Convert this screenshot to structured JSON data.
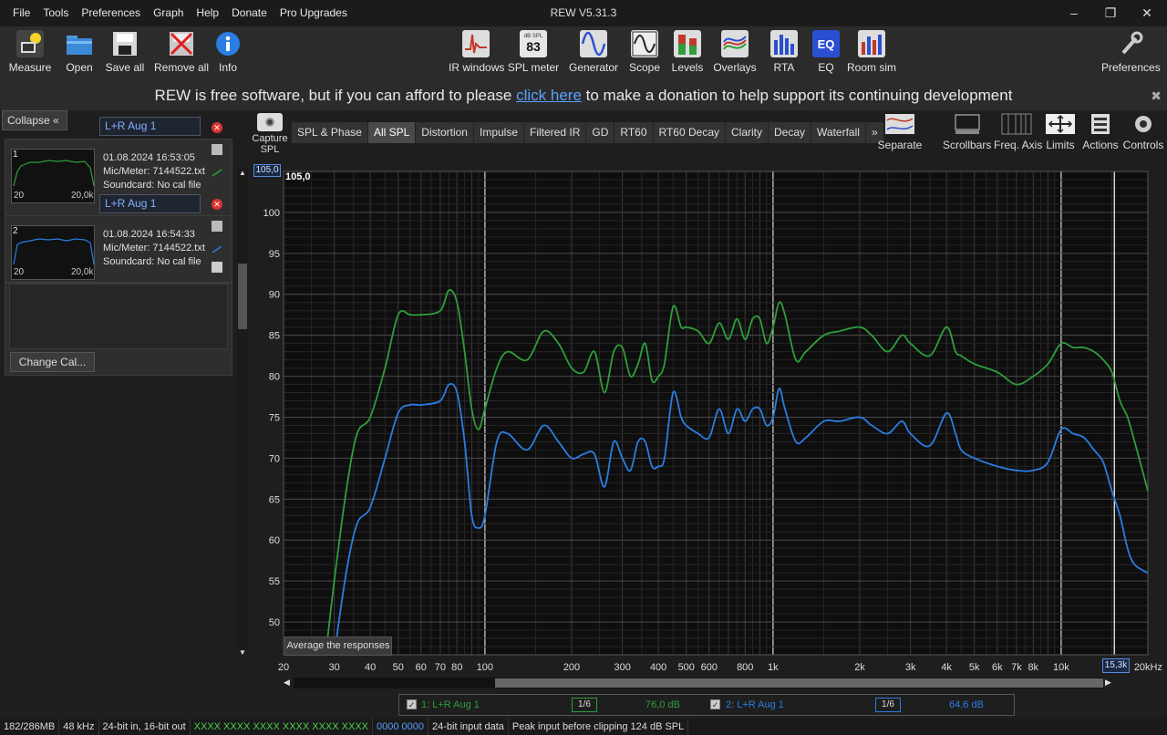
{
  "window": {
    "title": "REW V5.31.3"
  },
  "menu": [
    "File",
    "Tools",
    "Preferences",
    "Graph",
    "Help",
    "Donate",
    "Pro Upgrades"
  ],
  "toolbar_left": [
    "Measure",
    "Open",
    "Save all",
    "Remove all",
    "Info"
  ],
  "toolbar_center": [
    "IR windows",
    "SPL meter",
    "Generator",
    "Scope",
    "Levels",
    "Overlays",
    "RTA",
    "EQ",
    "Room sim"
  ],
  "spl_meter_icon": {
    "unit": "dB SPL",
    "value": "83"
  },
  "eq_icon_text": "EQ",
  "toolbar_right": "Preferences",
  "banner": {
    "before": "REW is free software, but if you can afford to please ",
    "link": "click here",
    "after": " to make a donation to help support its continuing development"
  },
  "left_panel": {
    "collapse": "Collapse",
    "measurements": [
      {
        "num": "1",
        "name": "L+R Aug 1",
        "date": "01.08.2024 16:53:05",
        "mic": "Mic/Meter: 7144522.txt",
        "soundcard": "Soundcard: No cal file",
        "thumb_left": "20",
        "thumb_right": "20,0k",
        "color": "#2e9e3a"
      },
      {
        "num": "2",
        "name": "L+R Aug 1",
        "date": "01.08.2024 16:54:33",
        "mic": "Mic/Meter: 7144522.txt",
        "soundcard": "Soundcard: No cal file",
        "thumb_left": "20",
        "thumb_right": "20,0k",
        "color": "#2a7de1"
      }
    ],
    "change_cal": "Change Cal..."
  },
  "capture": {
    "label": "Capture",
    "sub": "SPL"
  },
  "tabs": [
    "SPL & Phase",
    "All SPL",
    "Distortion",
    "Impulse",
    "Filtered IR",
    "GD",
    "RT60",
    "RT60 Decay",
    "Clarity",
    "Decay",
    "Waterfall",
    "»"
  ],
  "active_tab": "All SPL",
  "right_tools": [
    "Separate",
    "Scrollbars",
    "Freq. Axis",
    "Limits",
    "Actions",
    "Controls"
  ],
  "graph": {
    "y_top_label": "105,0",
    "avg_button": "Average the responses",
    "cursor_x": "15,3k"
  },
  "chart_data": {
    "type": "line",
    "xscale": "log",
    "xlim": [
      20,
      20000
    ],
    "ylim": [
      46,
      105
    ],
    "x_ticks": [
      {
        "v": 20,
        "t": "20"
      },
      {
        "v": 30,
        "t": "30"
      },
      {
        "v": 40,
        "t": "40"
      },
      {
        "v": 50,
        "t": "50"
      },
      {
        "v": 60,
        "t": "60"
      },
      {
        "v": 70,
        "t": "70"
      },
      {
        "v": 80,
        "t": "80"
      },
      {
        "v": 100,
        "t": "100"
      },
      {
        "v": 200,
        "t": "200"
      },
      {
        "v": 300,
        "t": "300"
      },
      {
        "v": 400,
        "t": "400"
      },
      {
        "v": 500,
        "t": "500"
      },
      {
        "v": 600,
        "t": "600"
      },
      {
        "v": 800,
        "t": "800"
      },
      {
        "v": 1000,
        "t": "1k"
      },
      {
        "v": 2000,
        "t": "2k"
      },
      {
        "v": 3000,
        "t": "3k"
      },
      {
        "v": 4000,
        "t": "4k"
      },
      {
        "v": 5000,
        "t": "5k"
      },
      {
        "v": 6000,
        "t": "6k"
      },
      {
        "v": 7000,
        "t": "7k"
      },
      {
        "v": 8000,
        "t": "8k"
      },
      {
        "v": 10000,
        "t": "10k"
      },
      {
        "v": 20000,
        "t": "20kHz"
      }
    ],
    "y_ticks": [
      {
        "v": 105,
        "t": "105,0"
      },
      {
        "v": 100,
        "t": "100"
      },
      {
        "v": 95,
        "t": "95"
      },
      {
        "v": 90,
        "t": "90"
      },
      {
        "v": 85,
        "t": "85"
      },
      {
        "v": 80,
        "t": "80"
      },
      {
        "v": 75,
        "t": "75"
      },
      {
        "v": 70,
        "t": "70"
      },
      {
        "v": 65,
        "t": "65"
      },
      {
        "v": 60,
        "t": "60"
      },
      {
        "v": 55,
        "t": "55"
      },
      {
        "v": 50,
        "t": "50"
      }
    ],
    "cursor_freq": 15300,
    "series": [
      {
        "name": "1: L+R Aug 1",
        "color": "#2e9e3a",
        "x": [
          28,
          30,
          33,
          36,
          40,
          45,
          50,
          55,
          60,
          70,
          75,
          80,
          85,
          90,
          95,
          100,
          110,
          120,
          140,
          160,
          180,
          200,
          220,
          240,
          260,
          280,
          300,
          320,
          340,
          360,
          380,
          400,
          420,
          450,
          480,
          500,
          550,
          600,
          650,
          700,
          750,
          800,
          850,
          900,
          950,
          1000,
          1050,
          1100,
          1200,
          1300,
          1500,
          1700,
          2000,
          2200,
          2500,
          2800,
          3000,
          3500,
          4000,
          4300,
          4500,
          5000,
          6000,
          7000,
          8000,
          9000,
          10000,
          11000,
          12000,
          13000,
          14000,
          15000,
          16000,
          17000,
          18000,
          20000
        ],
        "y": [
          46,
          55,
          66,
          73,
          75,
          81,
          87.5,
          87.5,
          87.5,
          88,
          90.5,
          89,
          83,
          76,
          73.5,
          76,
          81,
          83,
          82,
          85.5,
          84,
          81,
          80.5,
          83,
          78,
          83,
          83.5,
          80,
          81.5,
          84,
          79.5,
          80,
          81.5,
          88.5,
          86,
          86,
          85.5,
          84,
          86.5,
          84.5,
          87,
          84.5,
          87,
          87,
          84,
          86,
          89,
          87.5,
          82,
          83,
          85,
          85.5,
          86,
          85,
          83,
          85,
          84,
          82.5,
          86,
          83,
          82.5,
          81.5,
          80.5,
          79,
          80,
          81.5,
          84,
          83.5,
          83.5,
          83,
          82,
          80.5,
          77,
          75,
          72,
          66
        ]
      },
      {
        "name": "2: L+R Aug 1",
        "color": "#2a7de1",
        "x": [
          30,
          33,
          36,
          40,
          45,
          50,
          55,
          60,
          70,
          75,
          80,
          85,
          90,
          95,
          100,
          110,
          120,
          140,
          160,
          180,
          200,
          220,
          240,
          260,
          280,
          300,
          320,
          340,
          360,
          380,
          400,
          420,
          450,
          480,
          500,
          550,
          600,
          650,
          700,
          750,
          800,
          850,
          900,
          950,
          1000,
          1050,
          1100,
          1200,
          1300,
          1500,
          1700,
          2000,
          2200,
          2500,
          2800,
          3000,
          3500,
          4000,
          4300,
          4500,
          5000,
          6000,
          7000,
          8000,
          9000,
          10000,
          11000,
          12000,
          13000,
          14000,
          15000,
          16000,
          17000,
          18000,
          20000
        ],
        "y": [
          46,
          56,
          62,
          64,
          70,
          75.5,
          76.5,
          76.5,
          77,
          79,
          78,
          72,
          63,
          61.5,
          63,
          72,
          73,
          71,
          74,
          72,
          70,
          70.5,
          70.5,
          66.5,
          72,
          70,
          68.5,
          72,
          72,
          69,
          69,
          70,
          78,
          75,
          74,
          73,
          72.5,
          76,
          73,
          76,
          74.5,
          76,
          76,
          74,
          75,
          78.5,
          76,
          72,
          72.5,
          74.5,
          74.5,
          75,
          74,
          73,
          74.5,
          73,
          71.5,
          75.5,
          73,
          71,
          70,
          69,
          68.5,
          68.5,
          69.5,
          73.5,
          73,
          72.5,
          71,
          69.5,
          66,
          63,
          59,
          57,
          56
        ]
      }
    ]
  },
  "legend": [
    {
      "label": "1: L+R Aug 1",
      "smoothing": "1/6",
      "value": "76,0 dB",
      "color": "#2e9e3a"
    },
    {
      "label": "2: L+R Aug 1",
      "smoothing": "1/6",
      "value": "64,6 dB",
      "color": "#2a7de1"
    }
  ],
  "status": {
    "memory": "182/286MB",
    "rate": "48 kHz",
    "bits": "24-bit in, 16-bit out",
    "io_status": "XXXX XXXX XXXX XXXX XXXX XXXX",
    "io_status2": "0000 0000",
    "input_data": "24-bit input data",
    "peak": "Peak input before clipping 124 dB SPL"
  }
}
